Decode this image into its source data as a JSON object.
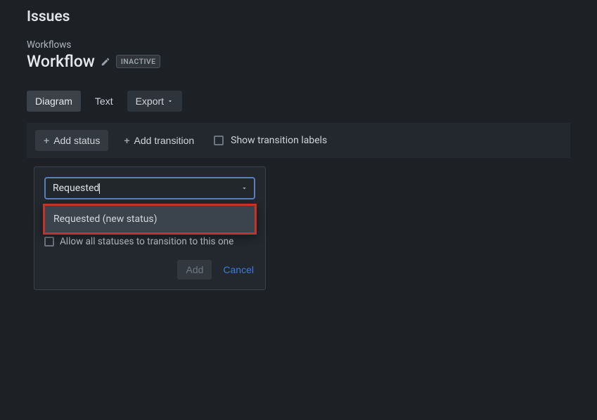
{
  "header": {
    "title": "Issues",
    "breadcrumb": "Workflows",
    "workflow_title": "Workflow",
    "status_badge": "INACTIVE"
  },
  "tabs": {
    "diagram": "Diagram",
    "text": "Text",
    "export": "Export"
  },
  "toolbar": {
    "add_status": "Add status",
    "add_transition": "Add transition",
    "show_labels": "Show transition labels"
  },
  "dialog": {
    "input_value": "Requested",
    "dropdown_option": "Requested (new status)",
    "allow_text": "Allow all statuses to transition to this one",
    "add": "Add",
    "cancel": "Cancel"
  }
}
